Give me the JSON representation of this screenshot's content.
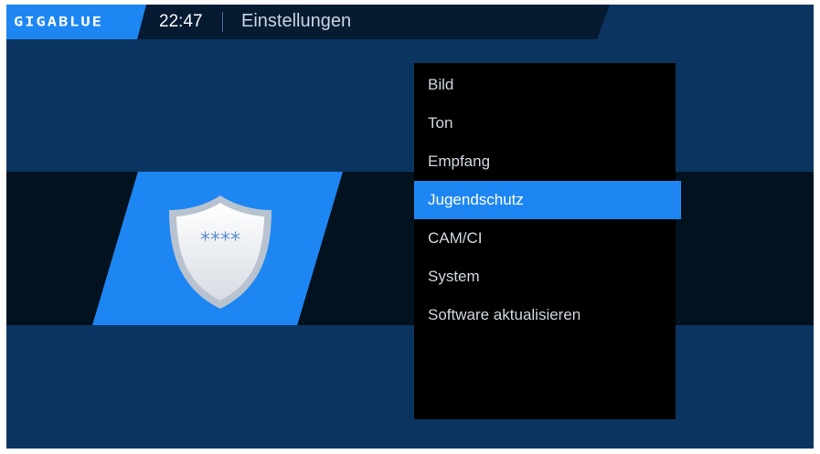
{
  "header": {
    "logo": "GIGABLUE",
    "time": "22:47",
    "title": "Einstellungen"
  },
  "menu": {
    "selected_index": 3,
    "items": [
      {
        "label": "Bild"
      },
      {
        "label": "Ton"
      },
      {
        "label": "Empfang"
      },
      {
        "label": "Jugendschutz"
      },
      {
        "label": "CAM/CI"
      },
      {
        "label": "System"
      },
      {
        "label": "Software aktualisieren"
      }
    ]
  },
  "icon": {
    "name": "parental-control-shield-icon",
    "text": "****"
  },
  "colors": {
    "background": "#0b3560",
    "topbar": "#061a32",
    "accent": "#1d86f2",
    "band": "#03121f",
    "menu_bg": "#000000"
  }
}
